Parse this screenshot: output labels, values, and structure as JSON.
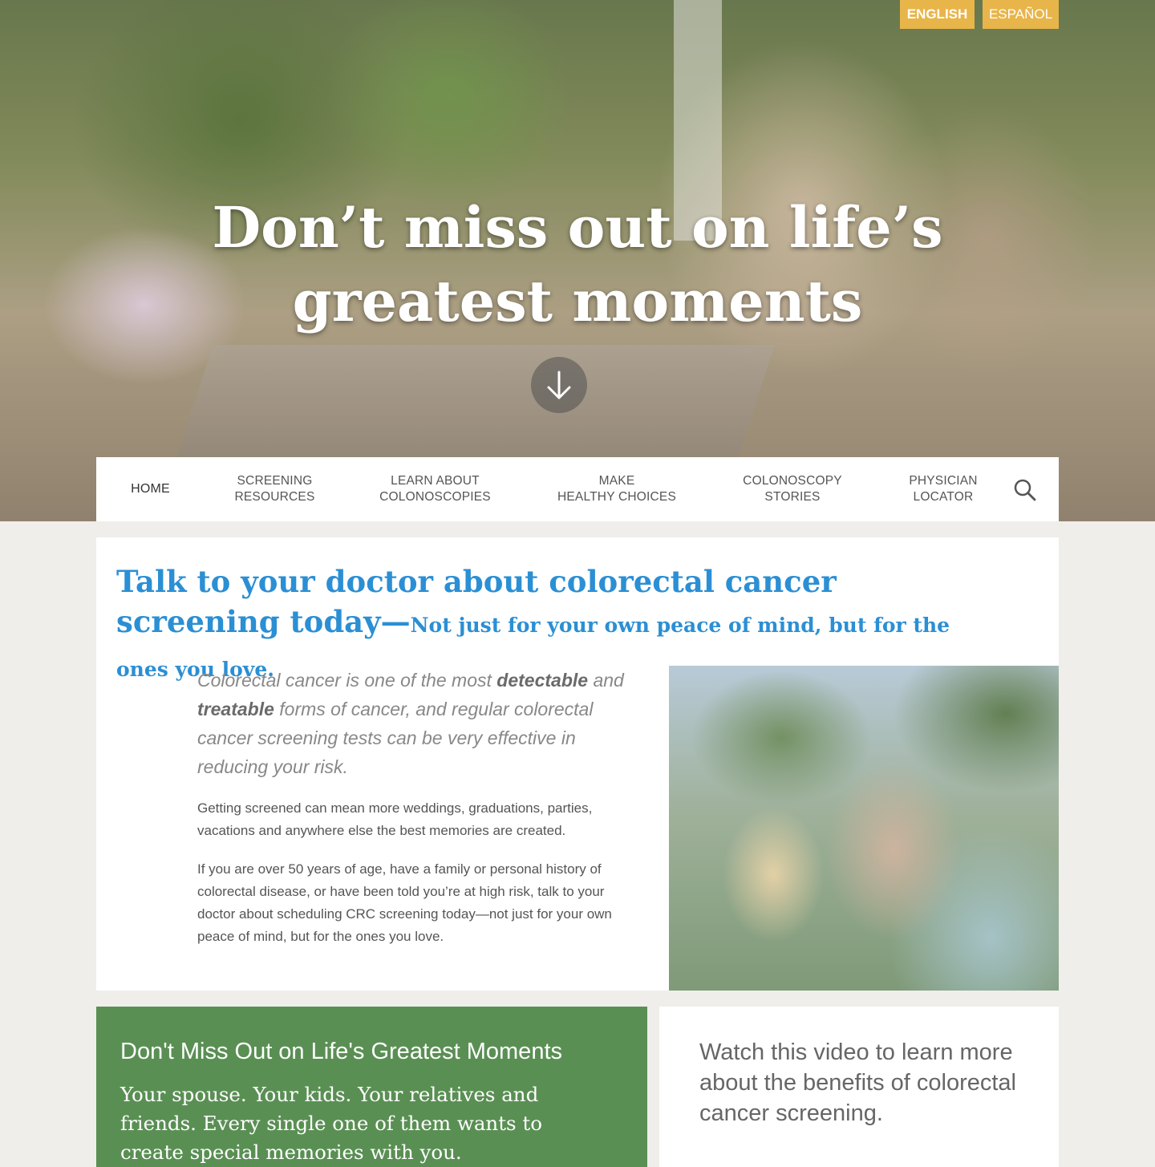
{
  "languages": {
    "english": "ENGLISH",
    "espanol": "ESPAÑOL"
  },
  "hero": {
    "title": "Don’t miss out on life’s greatest moments"
  },
  "nav": {
    "items": [
      {
        "label": "HOME"
      },
      {
        "label": "SCREENING\nRESOURCES"
      },
      {
        "label": "LEARN ABOUT\nCOLONOSCOPIES"
      },
      {
        "label": "MAKE\nHEALTHY CHOICES"
      },
      {
        "label": "COLONOSCOPY\nSTORIES"
      },
      {
        "label": "PHYSICIAN\nLOCATOR"
      }
    ],
    "search_icon": "search-icon"
  },
  "main": {
    "headline": "Talk to your doctor about colorectal cancer screening today—",
    "headline_sub": "Not just for your own peace of mind, but for the ones you love.",
    "intro_1": "Colorectal cancer is one of the most ",
    "intro_bold_1": "detectable",
    "intro_2": " and ",
    "intro_bold_2": "treatable",
    "intro_3": " forms of cancer, and regular colorectal cancer screening tests can be very effective in reducing your risk.",
    "para_1": "Getting screened can mean more weddings, graduations, parties, vacations and anywhere else the best memories are created.",
    "para_2": "If you are over 50 years of age, have a family or personal history of colorectal disease, or have been told you’re at high risk, talk to your doctor about scheduling CRC screening today—not just for your own peace of mind, but for the ones you love."
  },
  "green_box": {
    "title": "Don't Miss Out on Life's Greatest Moments",
    "text": "Your spouse. Your kids. Your relatives and friends. Every single one of them wants to create special memories with you."
  },
  "video_box": {
    "text": "Watch this video to learn more about the benefits of colorectal cancer screening."
  },
  "colors": {
    "accent_blue": "#2b8fd4",
    "lang_gold": "#e8b54a",
    "green": "#5a8f54"
  }
}
